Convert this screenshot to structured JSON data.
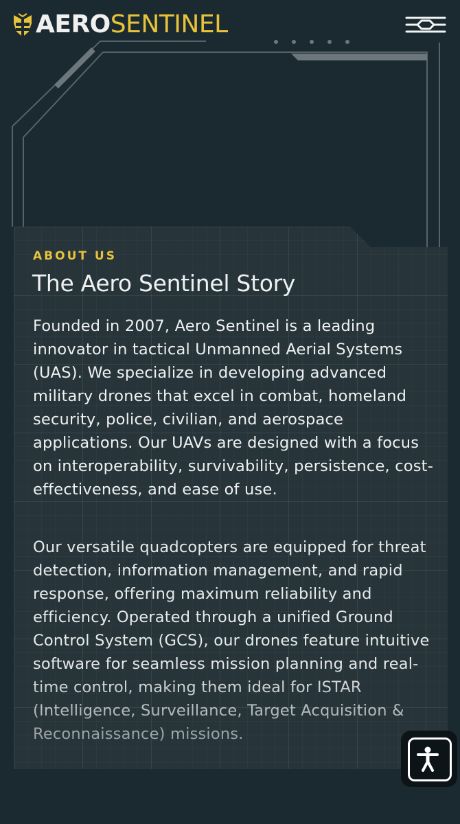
{
  "brand": {
    "name_part1": "AERO",
    "name_part2": "SENTINEL",
    "accent_color": "#e8c33a"
  },
  "header": {
    "menu_icon": "hamburger-menu-icon"
  },
  "about": {
    "eyebrow": "ABOUT US",
    "title": "The Aero Sentinel Story",
    "paragraphs": [
      "Founded in 2007, Aero Sentinel is a leading innovator in tactical Unmanned Aerial Systems (UAS). We specialize in developing advanced military drones that excel in combat, homeland security, police, civilian, and aerospace applications. Our UAVs are designed with a focus on interoperability, survivability, persistence, cost-effectiveness, and ease of use.",
      "Our versatile quadcopters are equipped for threat detection, information management, and rapid response, offering maximum reliability and efficiency. Operated through a unified Ground Control System (GCS), our drones feature intuitive software for seamless mission planning and real-time control, making them ideal for ISTAR (Intelligence, Surveillance, Target Acquisition & Reconnaissance) missions."
    ]
  },
  "accessibility": {
    "icon": "accessibility-person-icon"
  }
}
